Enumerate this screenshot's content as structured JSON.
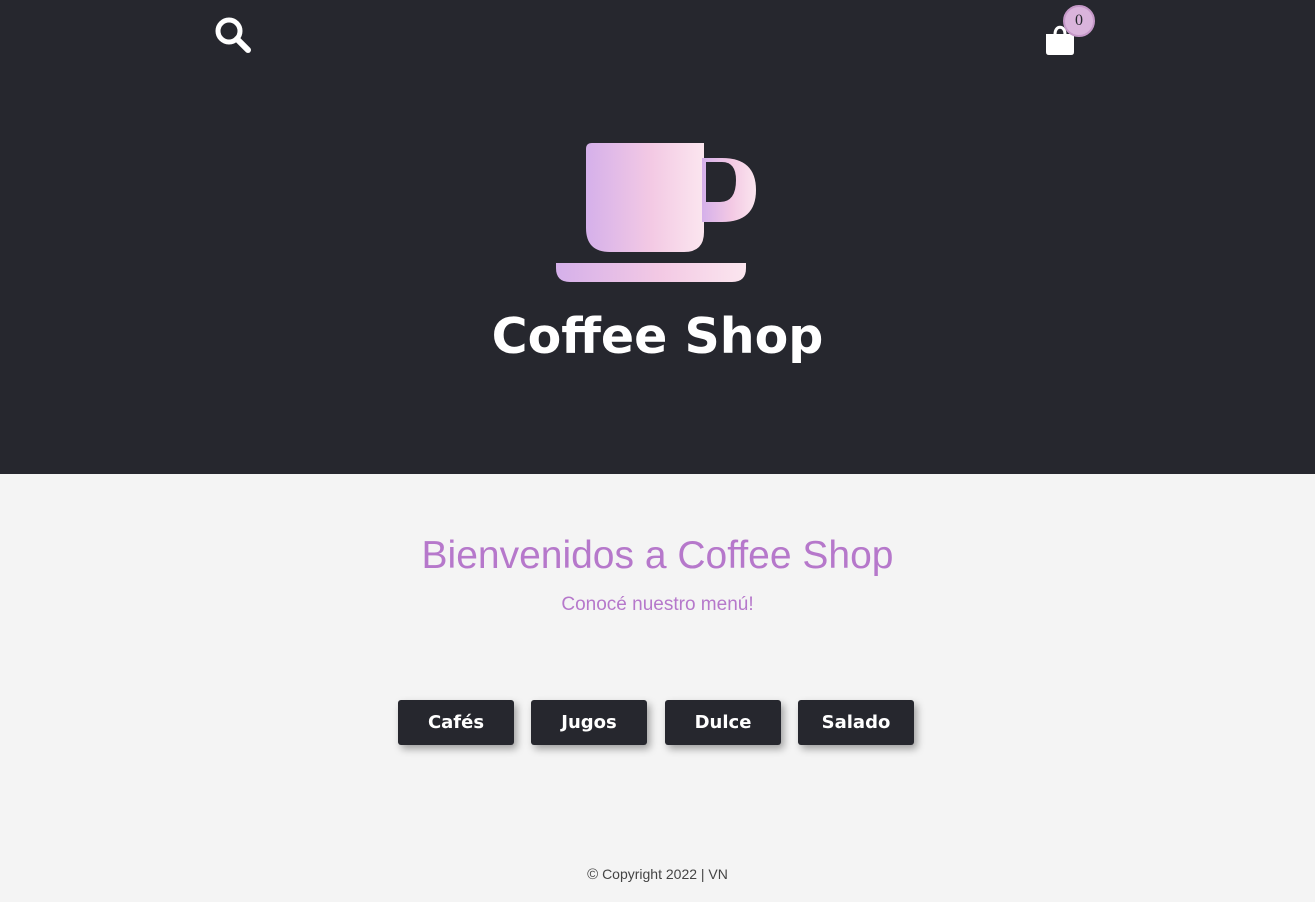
{
  "header": {
    "brand_title": "Coffee Shop",
    "icons": {
      "search": "search-icon",
      "cart": "shopping-bag-icon",
      "logo": "coffee-cup-icon"
    },
    "cart_count": "0"
  },
  "main": {
    "welcome_title": "Bienvenidos a Coffee Shop",
    "subtitle": "Conocé nuestro menú!",
    "categories": [
      {
        "label": "Cafés"
      },
      {
        "label": "Jugos"
      },
      {
        "label": "Dulce"
      },
      {
        "label": "Salado"
      }
    ]
  },
  "footer": {
    "copyright_symbol": "©",
    "text": "Copyright 2022 | VN"
  },
  "colors": {
    "header_bg": "#26272e",
    "page_bg": "#f4f4f4",
    "accent": "#b678cb",
    "badge": "#dab4dc",
    "button_bg": "#26272e"
  }
}
